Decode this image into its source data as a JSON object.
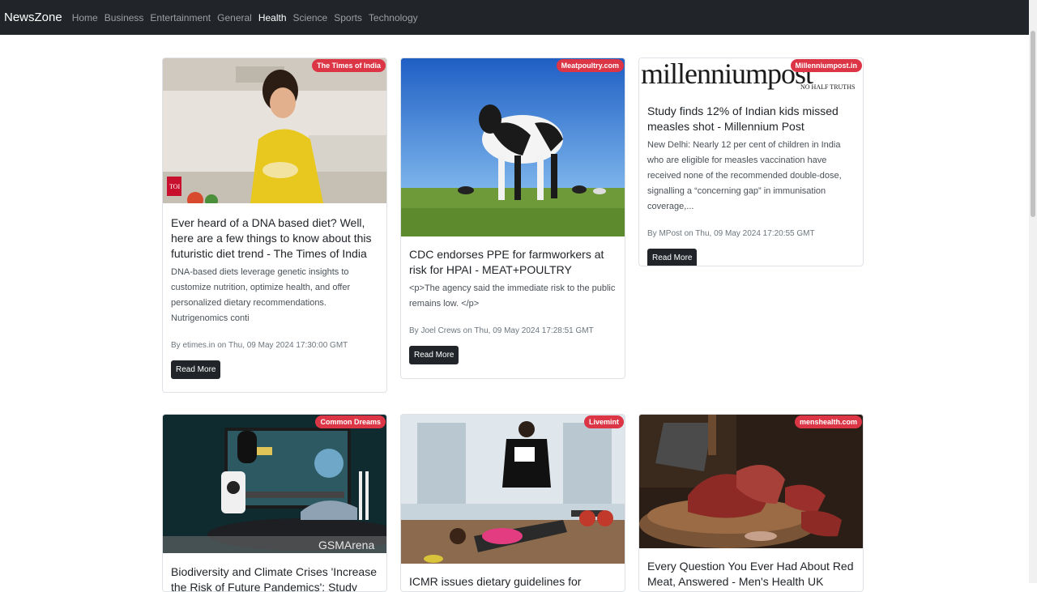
{
  "nav": {
    "brand": "NewsZone",
    "items": [
      {
        "label": "Home"
      },
      {
        "label": "Business"
      },
      {
        "label": "Entertainment"
      },
      {
        "label": "General"
      },
      {
        "label": "Health"
      },
      {
        "label": "Science"
      },
      {
        "label": "Sports"
      },
      {
        "label": "Technology"
      }
    ],
    "active": "Health"
  },
  "articles": [
    {
      "source": "The Times of India",
      "title": "Ever heard of a DNA based diet? Well, here are a few things to know about this futuristic diet trend - The Times of India",
      "description": "DNA-based diets leverage genetic insights to customize nutrition, optimize health, and offer personalized dietary recommendations. Nutrigenomics conti",
      "meta": "By etimes.in on Thu, 09 May 2024 17:30:00 GMT",
      "button": "Read More",
      "image_logo": "TOI"
    },
    {
      "source": "Meatpoultry.com",
      "title": "CDC endorses PPE for farmworkers at risk for HPAI - MEAT+POULTRY",
      "description": "<p>The agency said the immediate risk to the public remains low. </p>",
      "meta": "By Joel Crews on Thu, 09 May 2024 17:28:51 GMT",
      "button": "Read More"
    },
    {
      "source": "Millenniumpost.in",
      "title": "Study finds 12% of Indian kids missed measles shot - Millennium Post",
      "description": "New Delhi: Nearly 12 per cent of children in India who are eligible for measles vaccination have received none of the recommended double-dose, signalling a “concerning gap” in immunisation coverage,...",
      "meta": "By MPost on Thu, 09 May 2024 17:20:55 GMT",
      "button": "Read More",
      "image_logo": "millenniumpost",
      "image_tagline": "NO HALF TRUTHS"
    },
    {
      "source": "Common Dreams",
      "title": "Biodiversity and Climate Crises 'Increase the Risk of Future Pandemics': Study",
      "image_logo": "GSMArena"
    },
    {
      "source": "Livemint",
      "title": "ICMR issues dietary guidelines for Indians"
    },
    {
      "source": "menshealth.com",
      "title": "Every Question You Ever Had About Red Meat, Answered - Men's Health UK"
    }
  ]
}
